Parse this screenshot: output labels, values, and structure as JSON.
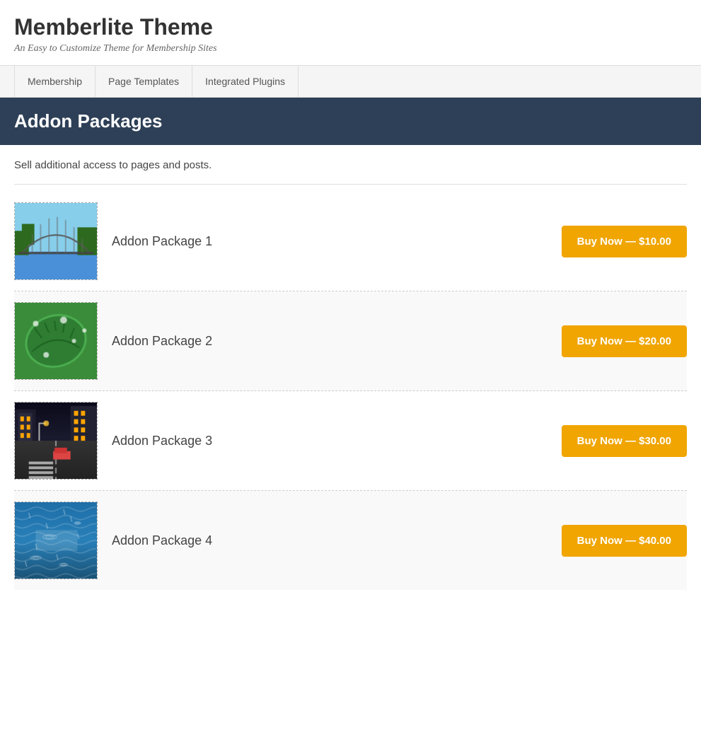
{
  "site": {
    "title": "Memberlite Theme",
    "tagline": "An Easy to Customize Theme for Membership Sites"
  },
  "nav": {
    "tabs": [
      {
        "label": "Membership",
        "id": "membership"
      },
      {
        "label": "Page Templates",
        "id": "page-templates"
      },
      {
        "label": "Integrated Plugins",
        "id": "integrated-plugins"
      }
    ]
  },
  "banner": {
    "title": "Addon Packages"
  },
  "page": {
    "description": "Sell additional access to pages and posts."
  },
  "packages": [
    {
      "name": "Addon Package 1",
      "price": "$10.00",
      "button_label": "Buy Now — $10.00",
      "image_type": "bridge"
    },
    {
      "name": "Addon Package 2",
      "price": "$20.00",
      "button_label": "Buy Now — $20.00",
      "image_type": "leaf"
    },
    {
      "name": "Addon Package 3",
      "price": "$30.00",
      "button_label": "Buy Now — $30.00",
      "image_type": "street"
    },
    {
      "name": "Addon Package 4",
      "price": "$40.00",
      "button_label": "Buy Now — $40.00",
      "image_type": "water"
    }
  ],
  "colors": {
    "banner_bg": "#2e4057",
    "button_bg": "#f0a500",
    "button_hover": "#d4920a"
  }
}
